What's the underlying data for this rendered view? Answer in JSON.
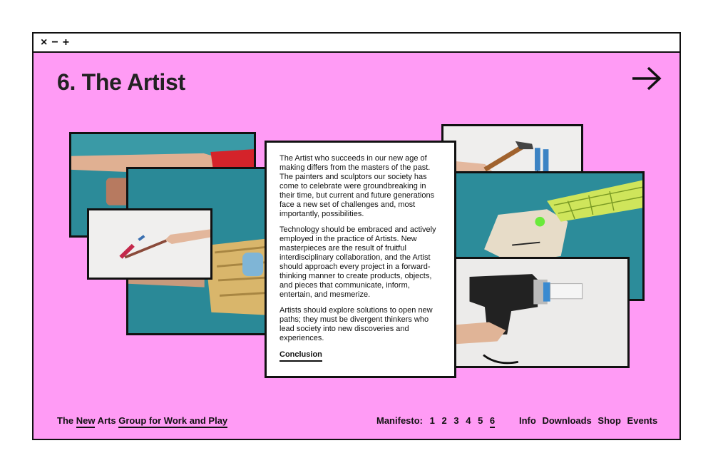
{
  "window": {
    "controls": {
      "close": "×",
      "minimize": "−",
      "maximize": "+"
    }
  },
  "page": {
    "title": "6. The Artist",
    "next_icon": "arrow-right-icon"
  },
  "photos": [
    {
      "name": "photo-hand-red-glove",
      "description_icon": "photo"
    },
    {
      "name": "photo-hand-sleeve-shiny",
      "description_icon": "photo"
    },
    {
      "name": "photo-hand-pencil",
      "description_icon": "photo"
    },
    {
      "name": "photo-hand-hammer",
      "description_icon": "photo"
    },
    {
      "name": "photo-hand-net-glove",
      "description_icon": "photo"
    },
    {
      "name": "photo-hand-drill",
      "description_icon": "photo"
    }
  ],
  "text": {
    "paragraphs": [
      "The Artist who succeeds in our new age of making differs from the masters of the past. The painters and sculptors our society has come to celebrate were groundbreaking in their time, but current and future generations face a new set of challenges and, most importantly, possibilities.",
      "Technology should be embraced and actively employed in the practice of Artists. New masterpieces are the result of fruitful interdisciplinary collaboration, and the Artist should approach every project in a forward-thinking manner to create products, objects, and pieces that communicate, inform, entertain, and mesmerize.",
      "Artists should explore solutions to open new paths; they must be divergent thinkers who lead society into new discoveries and experiences."
    ],
    "link": "Conclusion"
  },
  "footer": {
    "brand": {
      "the": "The",
      "new": "New",
      "arts": "Arts",
      "group": "Group for Work and Play"
    },
    "manifesto": {
      "label": "Manifesto:",
      "pages": [
        "1",
        "2",
        "3",
        "4",
        "5",
        "6"
      ],
      "current": "6"
    },
    "nav": [
      "Info",
      "Downloads",
      "Shop",
      "Events"
    ]
  },
  "colors": {
    "background": "#ff9bf5",
    "border": "#111111",
    "photo_teal": "#2b8f9d",
    "photo_white": "#ecebea"
  }
}
